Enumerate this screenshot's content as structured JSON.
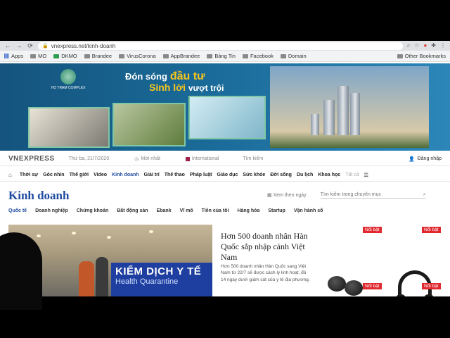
{
  "browser": {
    "url": "vnexpress.net/kinh-doanh",
    "bookmarks": [
      "Apps",
      "MO",
      "DKMO",
      "Brandee",
      "VirusCorona",
      "AppBrandee",
      "Bảng Tin",
      "Facebook",
      "Domain"
    ],
    "other_bookmarks": "Other Bookmarks"
  },
  "banner": {
    "brand": "HO TRAM COMPLEX",
    "slogan_prefix": "Đón sóng",
    "slogan_highlight": "đầu tư",
    "slogan2_highlight": "Sinh lời",
    "slogan2_suffix": "vượt trội"
  },
  "header": {
    "logo": "VNEXPRESS",
    "date": "Thứ ba, 21/7/2020",
    "latest": "Mới nhất",
    "international": "International",
    "search": "Tìm kiếm",
    "login": "Đăng nhập"
  },
  "main_nav": [
    "Thời sự",
    "Góc nhìn",
    "Thế giới",
    "Video",
    "Kinh doanh",
    "Giải trí",
    "Thể thao",
    "Pháp luật",
    "Giáo dục",
    "Sức khỏe",
    "Đời sống",
    "Du lịch",
    "Khoa học",
    "Tất cả"
  ],
  "category": {
    "title": "Kinh doanh",
    "date_filter": "Xem theo ngày",
    "search_placeholder": "Tìm kiếm trong chuyên mục"
  },
  "sub_nav": [
    "Quốc tế",
    "Doanh nghiệp",
    "Chứng khoán",
    "Bất động sản",
    "Ebank",
    "Vĩ mô",
    "Tiền của tôi",
    "Hàng hóa",
    "Startup",
    "Vận hành số"
  ],
  "article": {
    "title": "Hơn 500 doanh nhân Hàn Quốc sắp nhập cảnh Việt Nam",
    "description": "Hơn 500 doanh nhân Hàn Quốc sang Việt Nam từ 22/7 sẽ được cách ly linh hoạt, đủ 14 ngày dưới giám sát của y tế địa phương.",
    "image_sign": "KIỂM DỊCH Y TẾ",
    "image_sign_sub": "Health Quarantine"
  },
  "ads": {
    "badge": "Nổi bật"
  }
}
